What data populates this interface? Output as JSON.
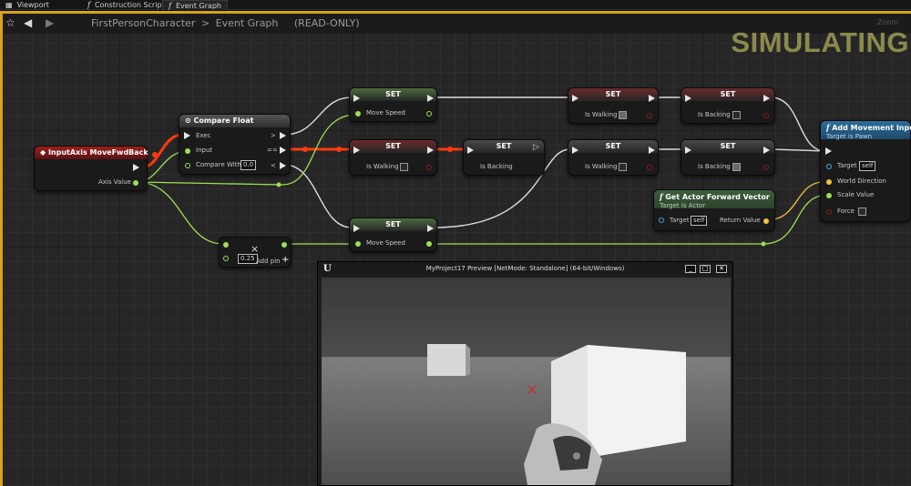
{
  "tabs": [
    {
      "label": "Viewport",
      "icon": "viewport-icon"
    },
    {
      "label": "Construction Scrip",
      "icon": "function-icon"
    },
    {
      "label": "Event Graph",
      "icon": "function-icon",
      "active": true
    }
  ],
  "breadcrumb": {
    "root": "FirstPersonCharacter",
    "separator": ">",
    "current": "Event Graph",
    "status": "(READ-ONLY)"
  },
  "overlay": {
    "simulating": "SIMULATING",
    "zoom": "Zoom"
  },
  "colors": {
    "accent_border": "#d8a21a",
    "exec_wire": "#e6e6e6",
    "active_wire": "#ff3a10",
    "float_pin": "#9fde55",
    "bool_pin": "#8c1a1a",
    "object_pin": "#3ea6e8",
    "vector_pin": "#f1c243"
  },
  "nodes": {
    "input_axis": {
      "title": "InputAxis MoveFwdBack",
      "axis_value": "Axis Value"
    },
    "compare_float": {
      "title": "Compare Float",
      "exec": "Exec",
      "input": "Input",
      "compare_with": "Compare With",
      "compare_value": "0.0",
      "out_gt": ">",
      "out_eq": "==",
      "out_lt": "<"
    },
    "set_move_speed_top": {
      "title": "SET",
      "pin": "Move Speed"
    },
    "set_walking_mid": {
      "title": "SET",
      "pin": "Is Walking",
      "value": false
    },
    "set_backing_mid": {
      "title": "SET",
      "pin": "Is Backing",
      "value": false
    },
    "set_walking_top_right": {
      "title": "SET",
      "pin": "Is Walking",
      "value": true
    },
    "set_backing_top_right": {
      "title": "SET",
      "pin": "Is Backing",
      "value": false
    },
    "set_walking_mid_right": {
      "title": "SET",
      "pin": "Is Walking",
      "value": false
    },
    "set_backing_mid_right": {
      "title": "SET",
      "pin": "Is Backing",
      "value": true
    },
    "set_move_speed_bottom": {
      "title": "SET",
      "pin": "Move Speed"
    },
    "multiply": {
      "value": "0.25",
      "add_pin": "Add pin",
      "op": "×",
      "plus": "+"
    },
    "get_forward": {
      "title": "Get Actor Forward Vector",
      "subtitle": "Target is Actor",
      "target": "Target",
      "target_value": "self",
      "return_value": "Return Value"
    },
    "add_movement": {
      "title": "Add Movement Input",
      "subtitle": "Target is Pawn",
      "target": "Target",
      "target_value": "self",
      "world_direction": "World Direction",
      "scale_value": "Scale Value",
      "force": "Force",
      "force_value": false
    }
  },
  "preview": {
    "title": "MyProject17 Preview [NetMode: Standalone] (64-bit/Windows)",
    "logo": "U",
    "minimize": "_",
    "maximize": "□",
    "close": "✕"
  }
}
